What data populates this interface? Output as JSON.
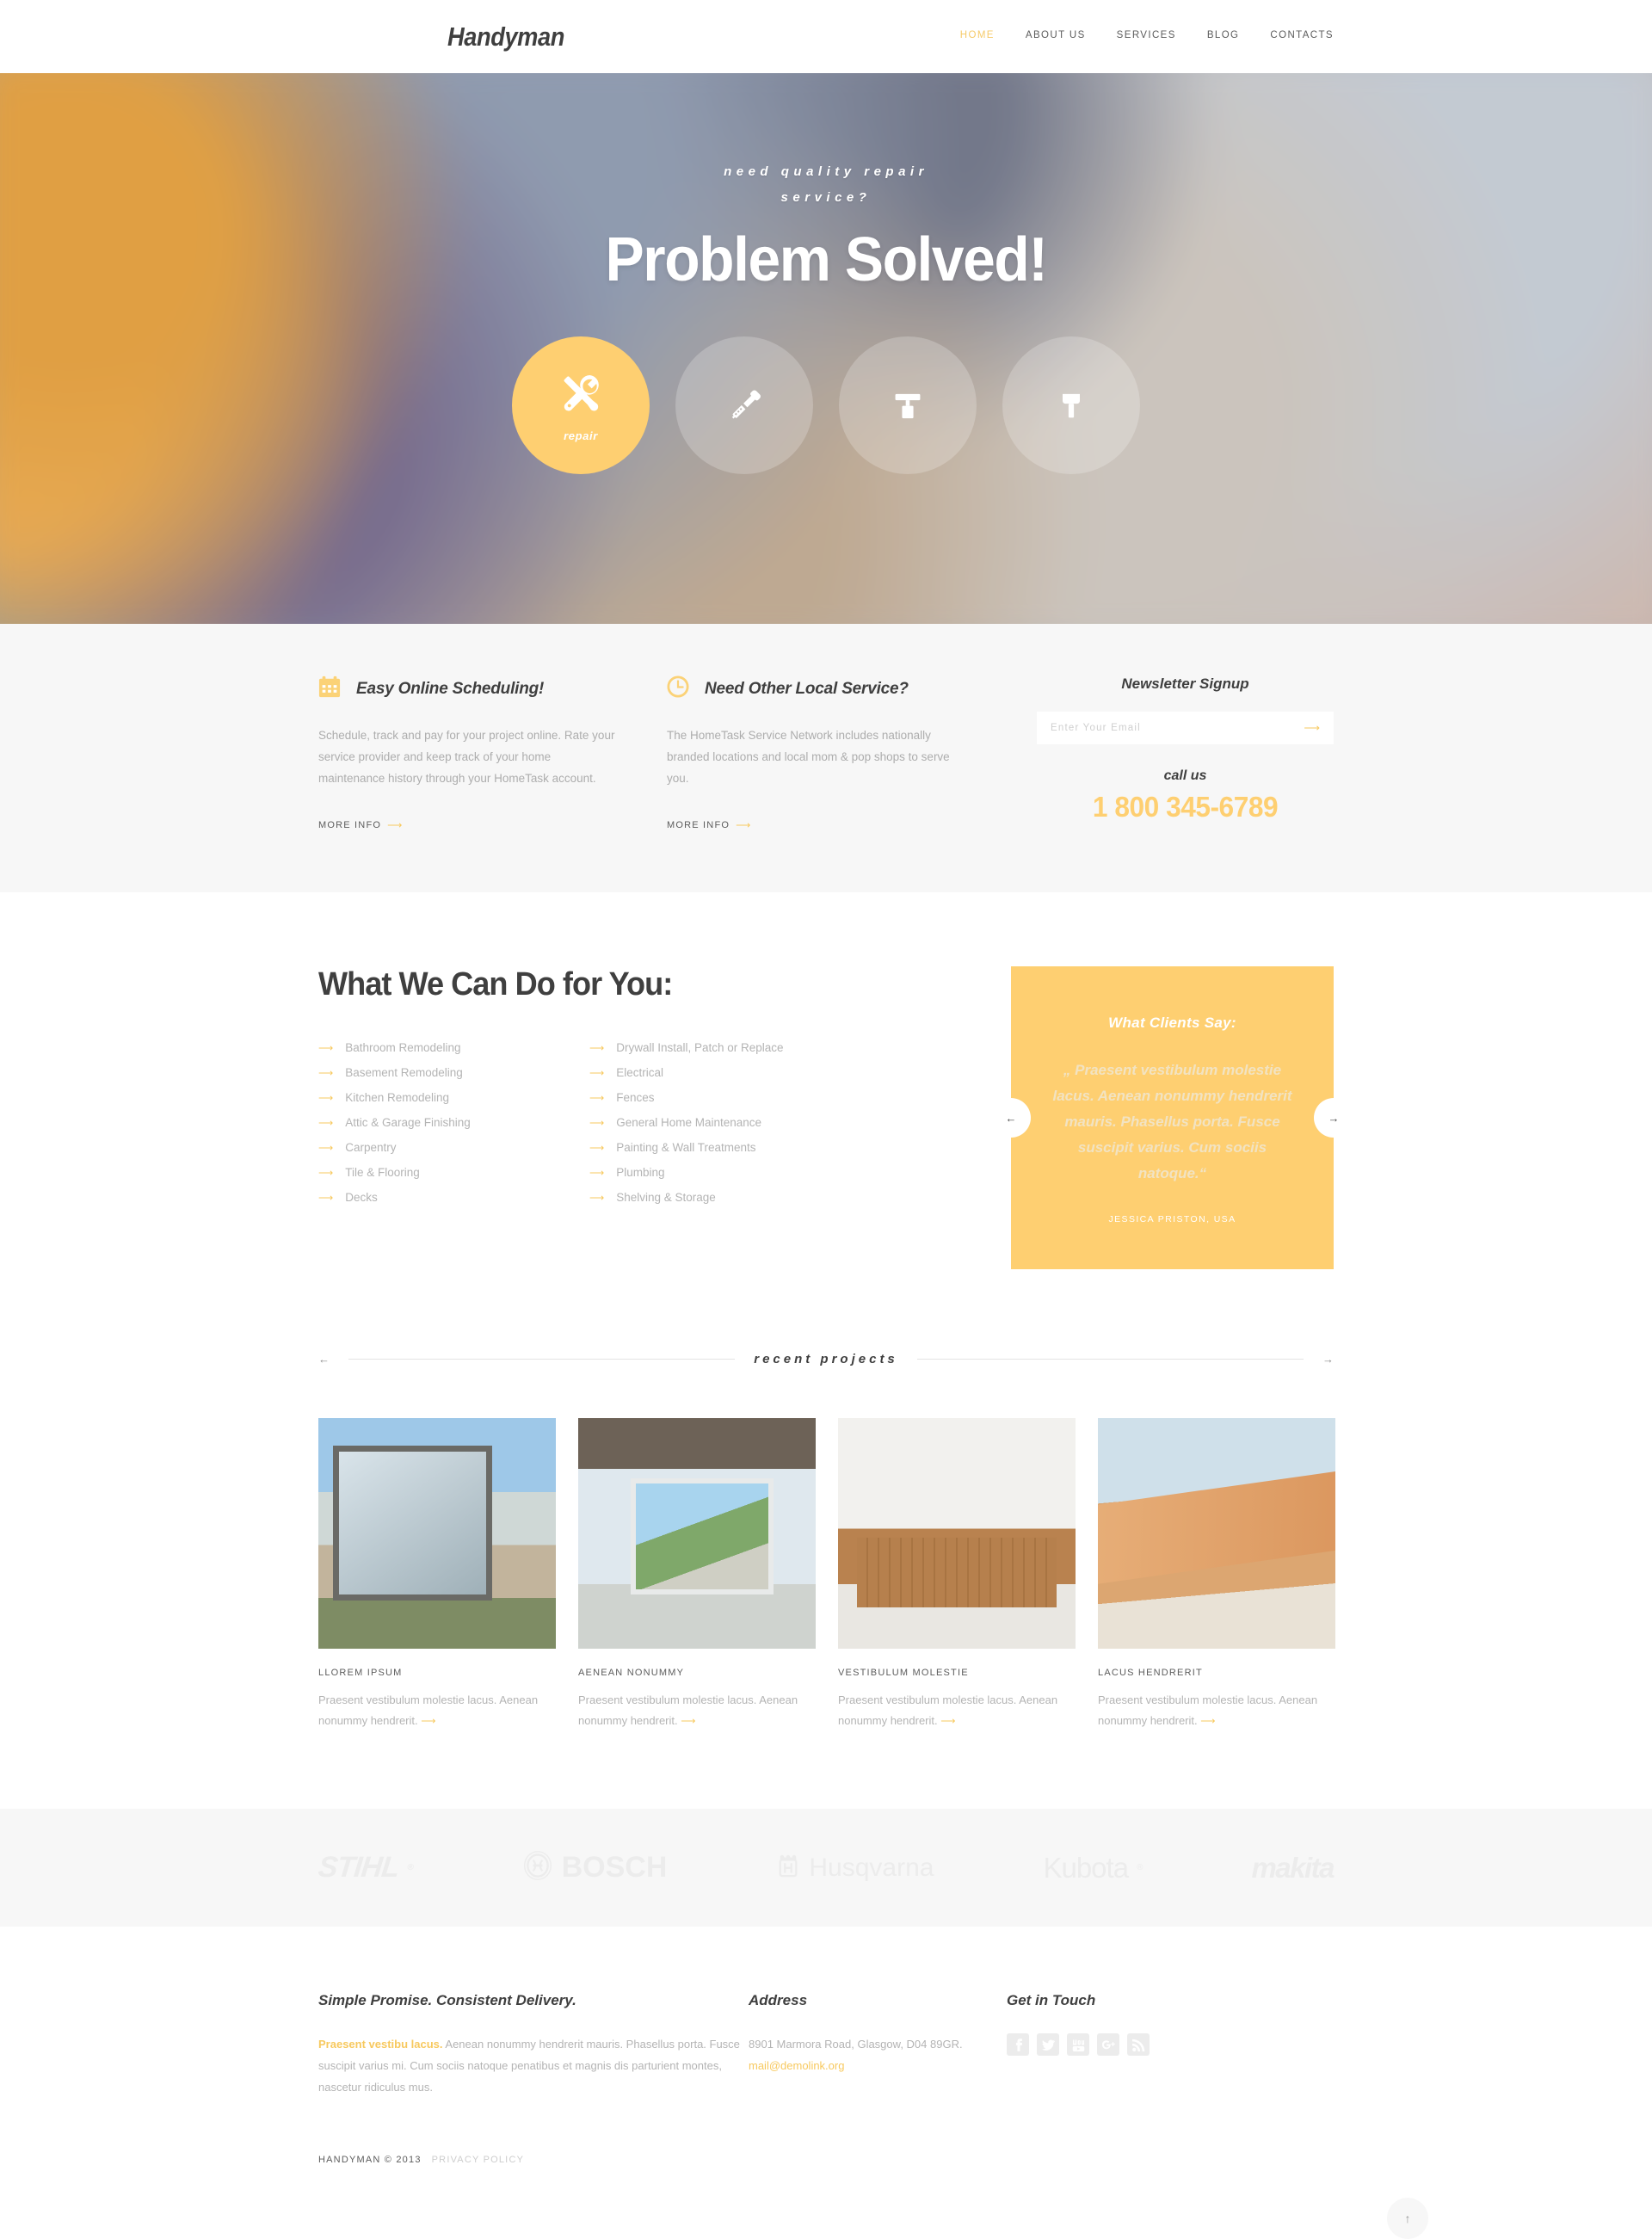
{
  "header": {
    "logo": "Handyman",
    "nav": [
      {
        "label": "HOME",
        "active": true
      },
      {
        "label": "ABOUT US",
        "active": false
      },
      {
        "label": "SERVICES",
        "active": false
      },
      {
        "label": "BLOG",
        "active": false
      },
      {
        "label": "CONTACTS",
        "active": false
      }
    ]
  },
  "hero": {
    "subtitle_line1": "need quality repair",
    "subtitle_line2": "service?",
    "title": "Problem Solved!",
    "circles": [
      {
        "icon": "wrench-screwdriver-icon",
        "label": "repair",
        "active": true
      },
      {
        "icon": "screwdriver-icon",
        "label": "",
        "active": false
      },
      {
        "icon": "paint-roller-icon",
        "label": "",
        "active": false
      },
      {
        "icon": "hammer-icon",
        "label": "",
        "active": false
      }
    ]
  },
  "features": [
    {
      "icon": "calendar-icon",
      "title": "Easy Online Scheduling!",
      "text": "Schedule, track and pay for your project online. Rate your service provider and keep track of your home maintenance history through your HomeTask account.",
      "more_label": "MORE INFO"
    },
    {
      "icon": "clock-icon",
      "title": "Need Other Local Service?",
      "text": "The HomeTask Service Network includes nationally branded locations and local mom & pop shops to serve you.",
      "more_label": "MORE INFO"
    }
  ],
  "newsletter": {
    "title": "Newsletter Signup",
    "placeholder": "Enter Your Email",
    "value": "",
    "call_us_label": "call us",
    "phone": "1 800 345-6789"
  },
  "services": {
    "heading": "What We Can Do for You:",
    "column_left": [
      "Bathroom Remodeling",
      "Basement Remodeling",
      "Kitchen Remodeling",
      "Attic & Garage Finishing",
      "Carpentry",
      "Tile & Flooring",
      "Decks"
    ],
    "column_right": [
      "Drywall Install, Patch or Replace",
      "Electrical",
      "Fences",
      "General Home Maintenance",
      "Painting & Wall Treatments",
      "Plumbing",
      "Shelving & Storage"
    ]
  },
  "testimonial": {
    "heading": "What Clients Say:",
    "quote": "„ Praesent vestibulum molestie lacus. Aenean nonummy hendrerit mauris. Phasellus porta. Fusce suscipit varius. Cum sociis natoque.“",
    "author": "JESSICA PRISTON, USA",
    "prev": "←",
    "next": "→"
  },
  "projects": {
    "heading": "recent projects",
    "prev": "←",
    "next": "→",
    "items": [
      {
        "title": "LLOREM IPSUM",
        "text": "Praesent vestibulum molestie lacus. Aenean nonummy hendrerit."
      },
      {
        "title": "AENEAN NONUMMY",
        "text": "Praesent vestibulum molestie lacus. Aenean nonummy hendrerit."
      },
      {
        "title": "VESTIBULUM MOLESTIE",
        "text": "Praesent vestibulum molestie lacus. Aenean nonummy hendrerit."
      },
      {
        "title": "LACUS HENDRERIT",
        "text": "Praesent vestibulum molestie lacus. Aenean nonummy hendrerit."
      }
    ]
  },
  "brands": [
    {
      "name": "STIHL"
    },
    {
      "name": "BOSCH"
    },
    {
      "name": "Husqvarna"
    },
    {
      "name": "Kubota"
    },
    {
      "name": "makita"
    }
  ],
  "footer": {
    "about": {
      "title": "Simple Promise. Consistent Delivery.",
      "lead": "Praesent vestibu lacus.",
      "text": " Aenean nonummy hendrerit mauris. Phasellus porta. Fusce suscipit varius mi. Cum sociis natoque penatibus et magnis dis parturient montes, nascetur ridiculus mus."
    },
    "address": {
      "title": "Address",
      "line": "8901 Marmora Road, Glasgow, D04 89GR.",
      "email": "mail@demolink.org"
    },
    "social": {
      "title": "Get in Touch",
      "items": [
        "facebook-icon",
        "twitter-icon",
        "youtube-icon",
        "googleplus-icon",
        "rss-icon"
      ]
    },
    "copyright": "HANDYMAN © 2013",
    "privacy": "PRIVACY POLICY",
    "to_top": "↑"
  },
  "colors": {
    "accent": "#fecf71",
    "accent_text": "#f7c95f",
    "dark": "#3f3f3f",
    "muted": "#b4b4b4",
    "bg_grey": "#f7f7f7"
  }
}
